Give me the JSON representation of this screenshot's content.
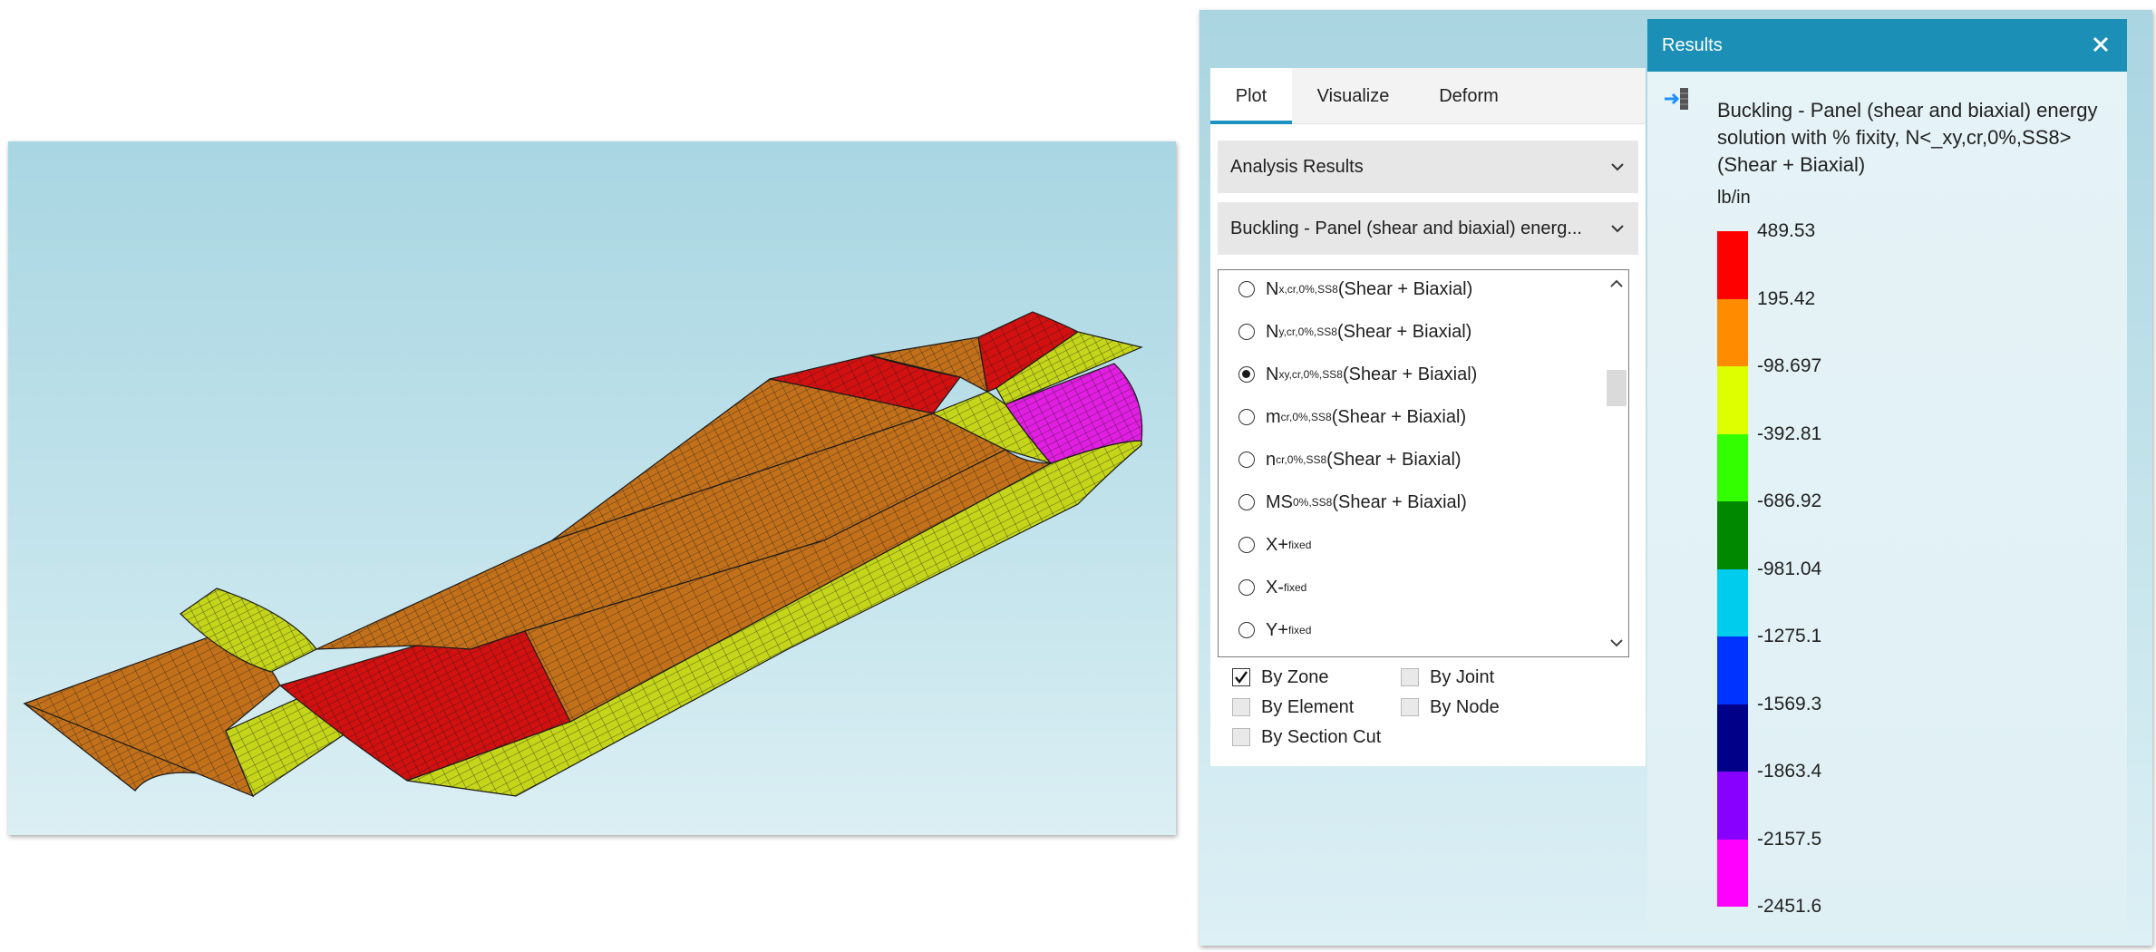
{
  "plot_panel": {
    "tabs": [
      {
        "label": "Plot"
      },
      {
        "label": "Visualize"
      },
      {
        "label": "Deform"
      }
    ],
    "analysis_dropdown": "Analysis Results",
    "method_dropdown": "Buckling - Panel (shear and biaxial) energ...",
    "options": [
      {
        "main": "N",
        "sub": "x,cr,0%,SS8",
        "rest": "(Shear + Biaxial)",
        "selected": false
      },
      {
        "main": "N",
        "sub": "y,cr,0%,SS8",
        "rest": "(Shear + Biaxial)",
        "selected": false
      },
      {
        "main": "N",
        "sub": "xy,cr,0%,SS8",
        "rest": "(Shear + Biaxial)",
        "selected": true
      },
      {
        "main": "m",
        "sub": "cr,0%,SS8",
        "rest": "(Shear + Biaxial)",
        "selected": false
      },
      {
        "main": "n",
        "sub": "cr,0%,SS8",
        "rest": "(Shear + Biaxial)",
        "selected": false
      },
      {
        "main": "MS",
        "sub": "0%,SS8",
        "rest": "(Shear + Biaxial)",
        "selected": false
      },
      {
        "main": "X+",
        "sub": "fixed",
        "rest": "",
        "selected": false
      },
      {
        "main": "X-",
        "sub": "fixed",
        "rest": "",
        "selected": false
      },
      {
        "main": "Y+",
        "sub": "fixed",
        "rest": "",
        "selected": false
      }
    ],
    "checkboxes": [
      {
        "label": "By Zone",
        "checked": true
      },
      {
        "label": "By Joint",
        "checked": false
      },
      {
        "label": "By Element",
        "checked": false
      },
      {
        "label": "By Node",
        "checked": false
      },
      {
        "label": "By Section Cut",
        "checked": false
      }
    ]
  },
  "results_window": {
    "title": "Results",
    "legend_title": "Buckling - Panel (shear and biaxial) energy solution with % fixity, N<_xy,cr,0%,SS8> (Shear + Biaxial)",
    "units": "lb/in",
    "labels": [
      "489.53",
      "195.42",
      "-98.697",
      "-392.81",
      "-686.92",
      "-981.04",
      "-1275.1",
      "-1569.3",
      "-1863.4",
      "-2157.5",
      "-2451.6"
    ],
    "colors": [
      "#ff0000",
      "#ff8c00",
      "#ddff00",
      "#33ff00",
      "#008800",
      "#00ccee",
      "#0033ff",
      "#000088",
      "#8800ff",
      "#ff00ff"
    ]
  },
  "model_colors": {
    "orange": "#c2701a",
    "red": "#d21010",
    "yellow": "#c4d51a",
    "magenta": "#e21ee2",
    "mesh": "#1a1a1a"
  }
}
